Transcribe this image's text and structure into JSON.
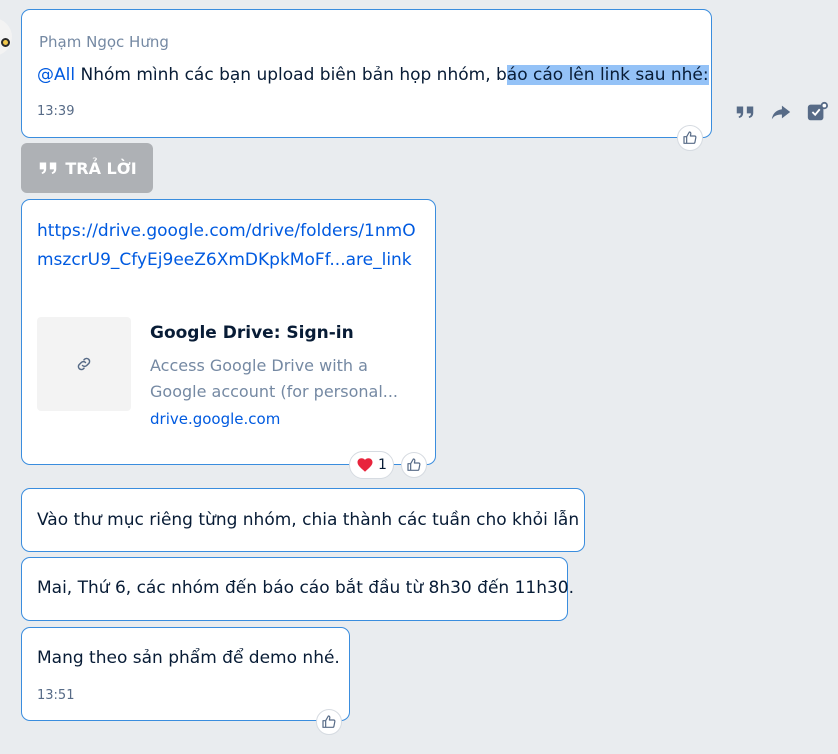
{
  "messages": {
    "m1": {
      "sender": "Phạm Ngọc Hưng",
      "mention": "@All",
      "text_plain": " Nhóm mình các bạn upload biên bản họp nhóm, b",
      "text_highlighted": "áo cáo lên link sau nhé:",
      "time": "13:39"
    },
    "m2": {
      "link_url": "https://drive.google.com/drive/folders/1nmOmszcrU9_CfyEj9eeZ6XmDKpkMoFf...are_link",
      "preview": {
        "title": "Google Drive: Sign-in",
        "desc_line1": "Access Google Drive with a",
        "desc_line2": "Google account (for personal...",
        "domain": "drive.google.com"
      },
      "reaction_count": "1"
    },
    "m3": {
      "text": "Vào thư mục riêng từng nhóm, chia thành các tuần cho khỏi lẫn"
    },
    "m4": {
      "text": "Mai, Thứ 6, các nhóm đến báo cáo bắt đầu từ 8h30 đến 11h30."
    },
    "m5": {
      "text": "Mang theo sản phẩm để demo nhé.",
      "time": "13:51"
    }
  },
  "reply_button": {
    "label": "TRẢ LỜI"
  },
  "icons": {
    "quote": "quote-icon",
    "forward": "forward-icon",
    "task": "task-icon",
    "like": "thumbs-up-icon",
    "heart": "heart-icon",
    "link": "link-icon"
  },
  "colors": {
    "accent": "#005ae0",
    "bubble_border": "#3a8dde",
    "highlight": "#94c2f7",
    "background": "#e9ecef"
  }
}
